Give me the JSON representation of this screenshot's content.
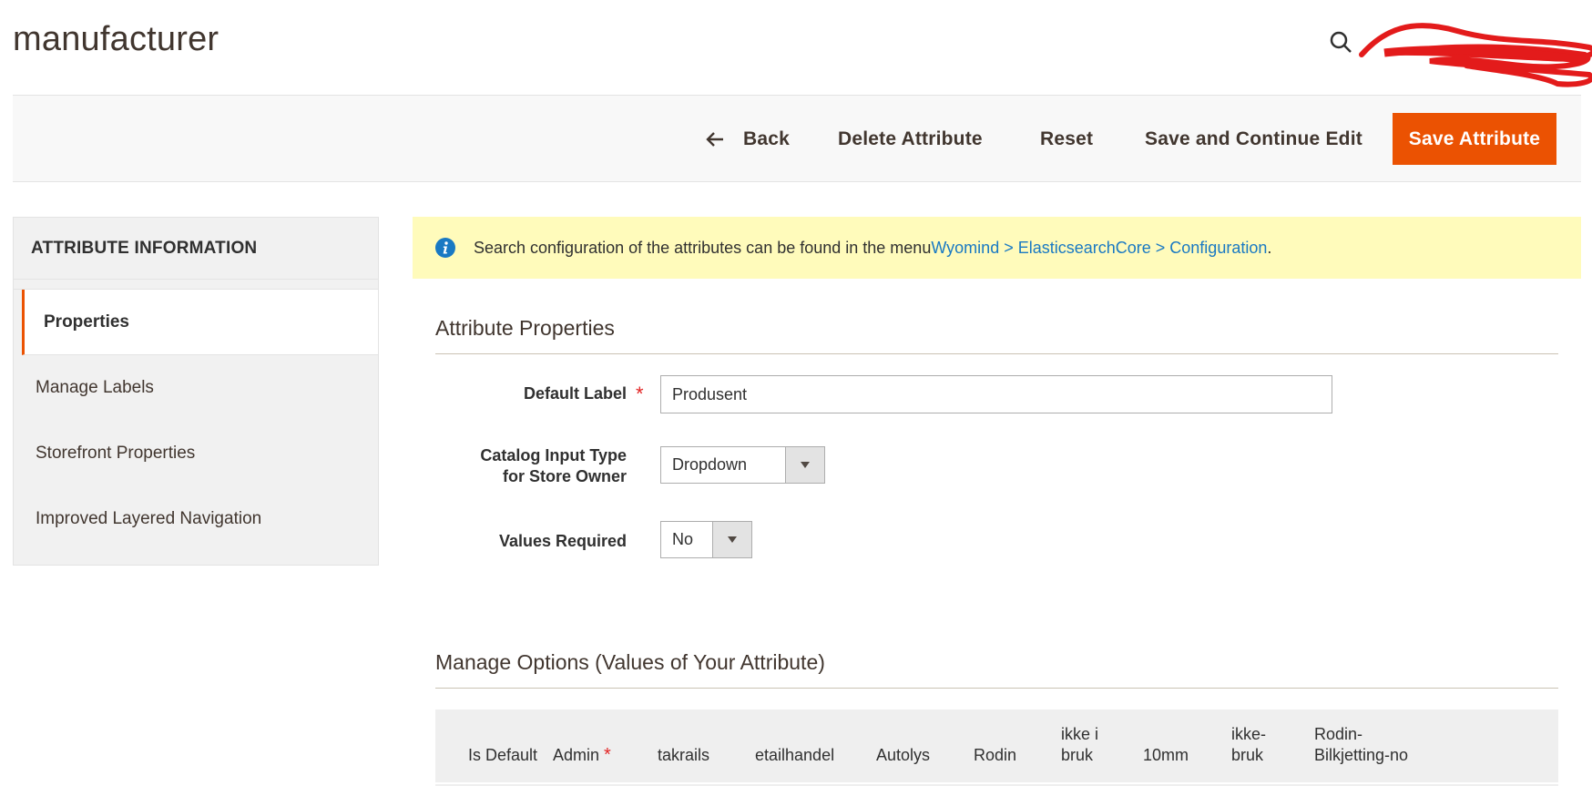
{
  "page": {
    "title": "manufacturer"
  },
  "header": {
    "search_icon": "search-icon",
    "redacted_account": "redacted-user-name"
  },
  "toolbar": {
    "back_label": "Back",
    "delete_label": "Delete Attribute",
    "reset_label": "Reset",
    "save_continue_label": "Save and Continue Edit",
    "save_label": "Save Attribute",
    "accent_color": "#eb5202"
  },
  "sidebar": {
    "title": "ATTRIBUTE INFORMATION",
    "items": [
      {
        "label": "Properties",
        "active": true
      },
      {
        "label": "Manage Labels",
        "active": false
      },
      {
        "label": "Storefront Properties",
        "active": false
      },
      {
        "label": "Improved Layered Navigation",
        "active": false
      }
    ]
  },
  "notice": {
    "icon": "info-icon",
    "text": "Search configuration of the attributes can be found in the menu ",
    "link_text": "Wyomind > ElasticsearchCore > Configuration",
    "suffix": "."
  },
  "properties": {
    "section_title": "Attribute Properties",
    "default_label": {
      "label": "Default Label",
      "required": "*",
      "value": "Produsent"
    },
    "input_type": {
      "label_line1": "Catalog Input Type",
      "label_line2": "for Store Owner",
      "value": "Dropdown"
    },
    "values_required": {
      "label": "Values Required",
      "value": "No"
    }
  },
  "options": {
    "section_title": "Manage Options (Values of Your Attribute)",
    "columns": [
      {
        "line1": "",
        "line2": "Is Default"
      },
      {
        "line1": "",
        "line2": "Admin",
        "required": "*"
      },
      {
        "line1": "",
        "line2": "takrails"
      },
      {
        "line1": "",
        "line2": "etailhandel"
      },
      {
        "line1": "",
        "line2": "Autolys"
      },
      {
        "line1": "",
        "line2": "Rodin"
      },
      {
        "line1": "ikke i",
        "line2": "bruk"
      },
      {
        "line1": "",
        "line2": "10mm"
      },
      {
        "line1": "ikke-",
        "line2": "bruk"
      },
      {
        "line1": "Rodin-",
        "line2": "Bilkjetting-no"
      }
    ]
  }
}
